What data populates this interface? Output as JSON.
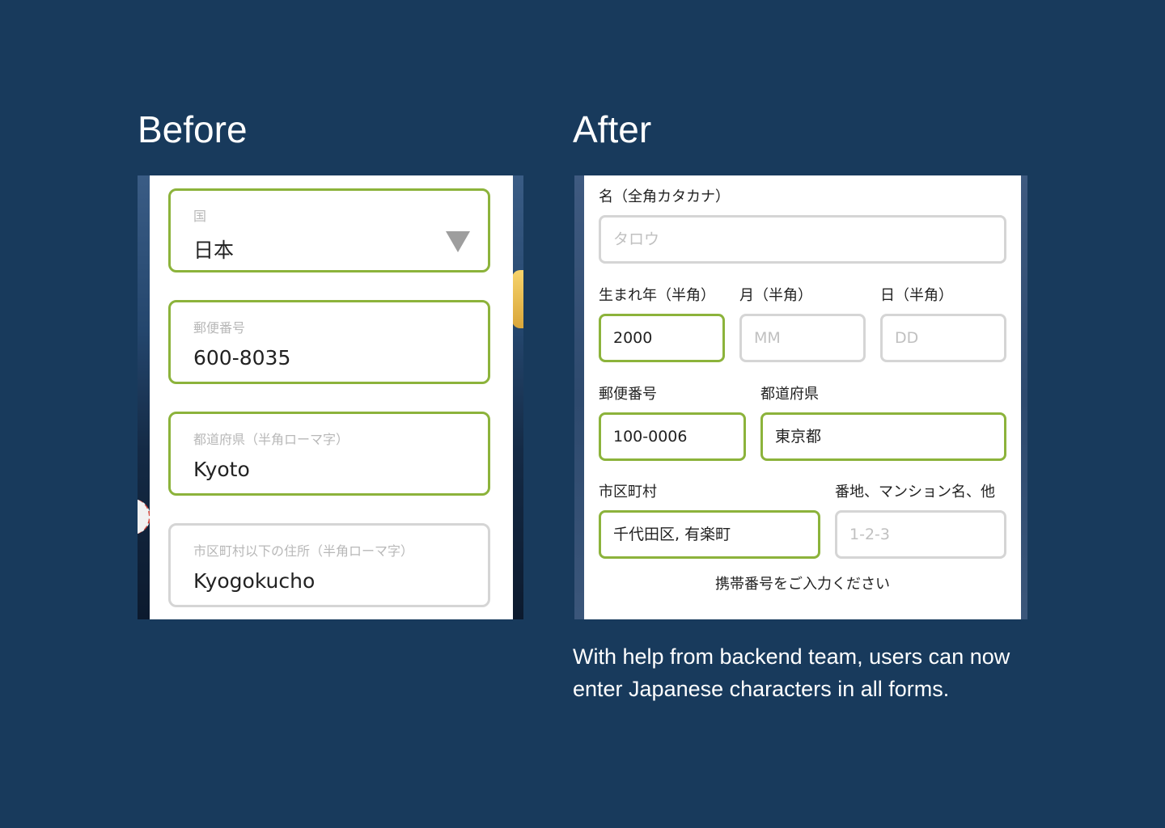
{
  "headings": {
    "before": "Before",
    "after": "After"
  },
  "before_form": {
    "country": {
      "label": "国",
      "value": "日本"
    },
    "postal": {
      "label": "郵便番号",
      "value": "600-8035"
    },
    "prefecture": {
      "label": "都道府県（半角ローマ字）",
      "value": "Kyoto"
    },
    "address": {
      "label": "市区町村以下の住所（半角ローマ字）",
      "value": "Kyogokucho"
    }
  },
  "after_form": {
    "name_katakana": {
      "label": "名（全角カタカナ）",
      "placeholder": "タロウ"
    },
    "birth_year": {
      "label": "生まれ年（半角）",
      "value": "2000"
    },
    "birth_month": {
      "label": "月（半角）",
      "placeholder": "MM"
    },
    "birth_day": {
      "label": "日（半角）",
      "placeholder": "DD"
    },
    "postal": {
      "label": "郵便番号",
      "value": "100-0006"
    },
    "prefecture": {
      "label": "都道府県",
      "value": "東京都"
    },
    "city": {
      "label": "市区町村",
      "value": "千代田区, 有楽町"
    },
    "street": {
      "label": "番地、マンション名、他",
      "placeholder": "1-2-3"
    },
    "mobile_prompt": "携帯番号をご入力ください"
  },
  "caption": "With help from backend team, users can now enter Japanese characters in all forms.",
  "colors": {
    "background": "#183a5c",
    "active_border": "#8cb33b",
    "inactive_border": "#d5d5d5"
  },
  "icons": {
    "dropdown": "triangle-down"
  }
}
